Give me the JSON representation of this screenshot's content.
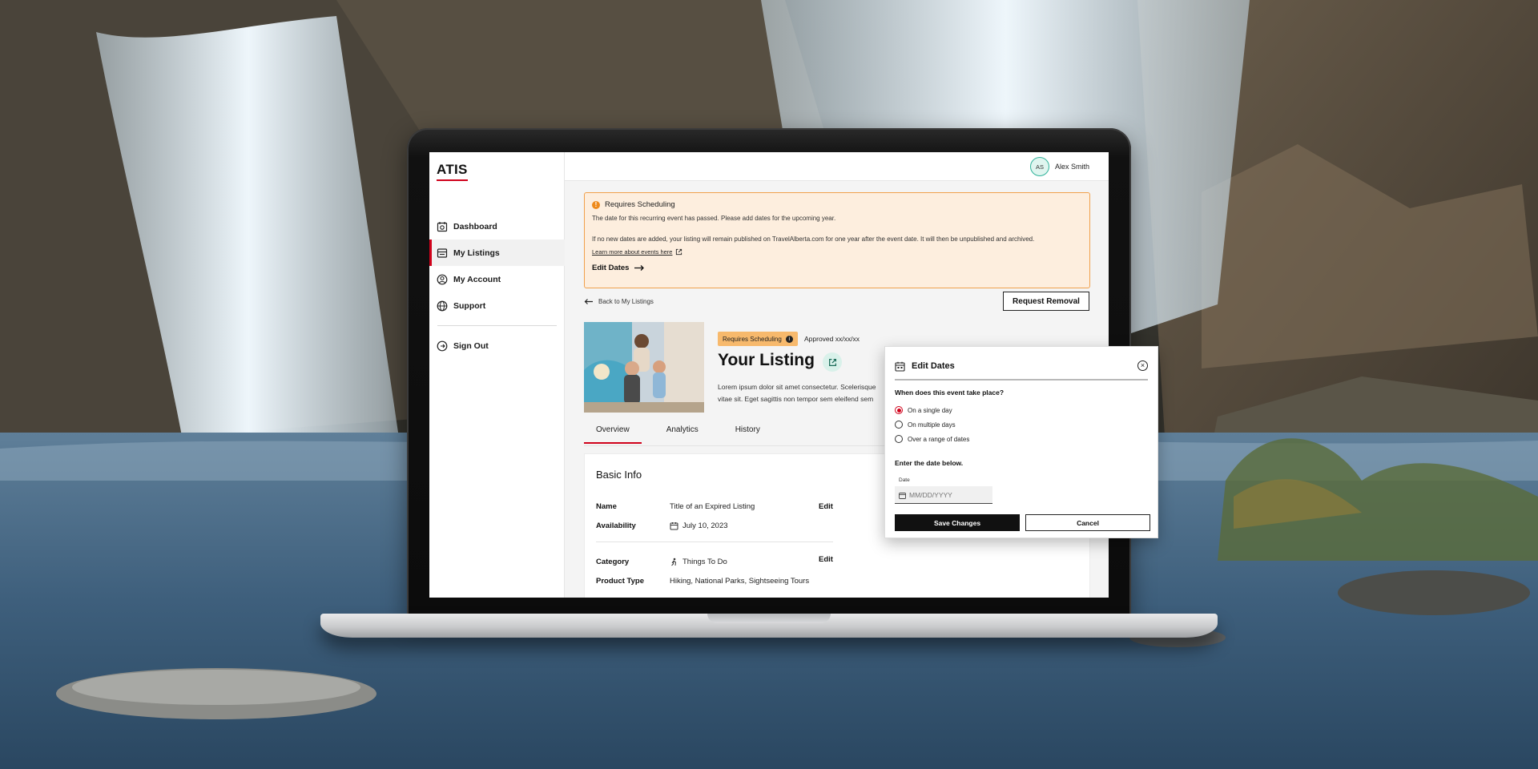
{
  "app": {
    "logo": "ATIS",
    "user": {
      "initials": "AS",
      "name": "Alex Smith"
    }
  },
  "sidebar": {
    "items": [
      {
        "label": "Dashboard",
        "icon": "dashboard-icon"
      },
      {
        "label": "My Listings",
        "icon": "listings-icon",
        "active": true
      },
      {
        "label": "My Account",
        "icon": "account-icon"
      },
      {
        "label": "Support",
        "icon": "globe-icon"
      }
    ],
    "sign_out": "Sign Out"
  },
  "alert": {
    "title": "Requires Scheduling",
    "line1": "The date for this recurring event has passed. Please add dates for the upcoming year.",
    "line2": "If no new dates are added, your listing will remain published on TravelAlberta.com for one year after the event date. It will then be unpublished and archived.",
    "link": "Learn more about events here",
    "action": "Edit Dates",
    "colors": {
      "background": "#fdeede",
      "border": "#f0a04b",
      "icon": "#ee8a1c"
    }
  },
  "nav": {
    "back": "Back to My Listings",
    "request_removal": "Request Removal"
  },
  "listing": {
    "badge": "Requires Scheduling",
    "approved": "Approved xx/xx/xx",
    "title": "Your Listing",
    "description_line1": "Lorem ipsum dolor sit amet consectetur. Scelerisque",
    "description_line2": "vitae sit. Eget sagittis non tempor sem eleifend sem"
  },
  "tabs": [
    {
      "label": "Overview",
      "active": true
    },
    {
      "label": "Analytics"
    },
    {
      "label": "History"
    }
  ],
  "basic_info": {
    "title": "Basic Info",
    "edit_label": "Edit",
    "rows": [
      {
        "label": "Name",
        "value": "Title of an Expired Listing"
      },
      {
        "label": "Availability",
        "value": "July 10, 2023"
      },
      {
        "label": "Category",
        "value": "Things To Do"
      },
      {
        "label": "Product Type",
        "value": "Hiking, National Parks, Sightseeing Tours"
      }
    ]
  },
  "modal": {
    "title": "Edit Dates",
    "question": "When does this event take place?",
    "options": [
      {
        "label": "On a single day",
        "selected": true
      },
      {
        "label": "On multiple days"
      },
      {
        "label": "Over a range of dates"
      }
    ],
    "enter_prompt": "Enter the date below.",
    "date_label": "Date",
    "date_placeholder": "MM/DD/YYYY",
    "save": "Save Changes",
    "cancel": "Cancel"
  },
  "colors": {
    "accent": "#d0021b",
    "badge": "#f7b96c",
    "avatar_ring": "#2fb39a",
    "primary_button": "#111111"
  }
}
